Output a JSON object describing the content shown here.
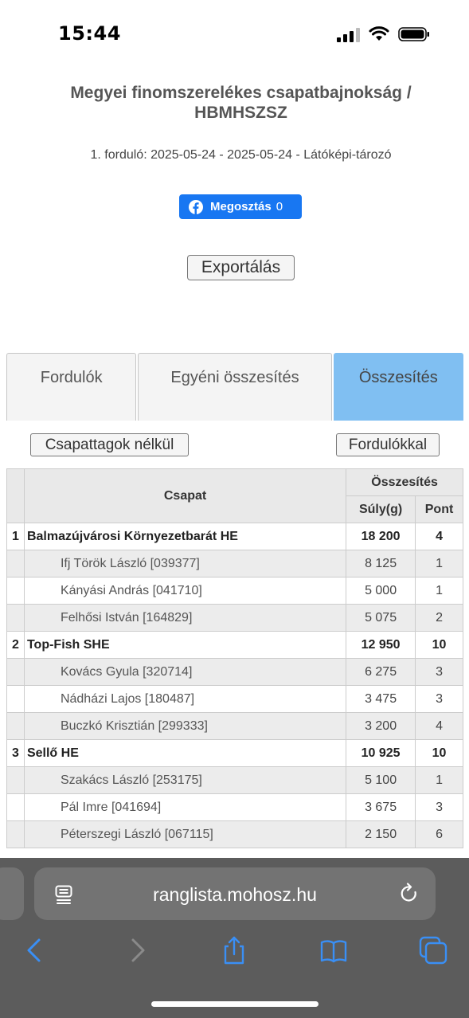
{
  "status": {
    "time": "15:44"
  },
  "header": {
    "title": "Megyei finomszerelékes csapatbajnokság / HBMHSZSZ",
    "round_info": "1. forduló: 2025-05-24 - 2025-05-24 - Látóképi-tározó",
    "share_label": "Megosztás",
    "share_count": "0",
    "export_label": "Exportálás"
  },
  "tabs": [
    {
      "label": "Fordulók",
      "active": false
    },
    {
      "label": "Egyéni összesítés",
      "active": false
    },
    {
      "label": "Összesítés",
      "active": true
    }
  ],
  "toggles": {
    "left": "Csapattagok nélkül",
    "right": "Fordulókkal"
  },
  "table": {
    "col_team": "Csapat",
    "col_group": "Összesítés",
    "col_weight": "Súly(g)",
    "col_points": "Pont",
    "teams": [
      {
        "rank": "1",
        "name": "Balmazújvárosi Környezetbarát HE",
        "weight": "18 200",
        "points": "4",
        "members": [
          {
            "name": "Ifj Török László [039377]",
            "weight": "8 125",
            "points": "1"
          },
          {
            "name": "Kányási András [041710]",
            "weight": "5 000",
            "points": "1"
          },
          {
            "name": "Felhősi István [164829]",
            "weight": "5 075",
            "points": "2"
          }
        ]
      },
      {
        "rank": "2",
        "name": "Top-Fish SHE",
        "weight": "12 950",
        "points": "10",
        "members": [
          {
            "name": "Kovács Gyula [320714]",
            "weight": "6 275",
            "points": "3"
          },
          {
            "name": "Nádházi Lajos [180487]",
            "weight": "3 475",
            "points": "3"
          },
          {
            "name": "Buczkó Krisztián [299333]",
            "weight": "3 200",
            "points": "4"
          }
        ]
      },
      {
        "rank": "3",
        "name": "Sellő HE",
        "weight": "10 925",
        "points": "10",
        "members": [
          {
            "name": "Szakács László [253175]",
            "weight": "5 100",
            "points": "1"
          },
          {
            "name": "Pál Imre [041694]",
            "weight": "3 675",
            "points": "3"
          },
          {
            "name": "Péterszegi László [067115]",
            "weight": "2 150",
            "points": "6"
          }
        ]
      }
    ]
  },
  "browser": {
    "url": "ranglista.mohosz.hu"
  },
  "colors": {
    "active_tab": "#80bff2",
    "facebook": "#1877f2",
    "ios_blue": "#3a8ff5"
  }
}
